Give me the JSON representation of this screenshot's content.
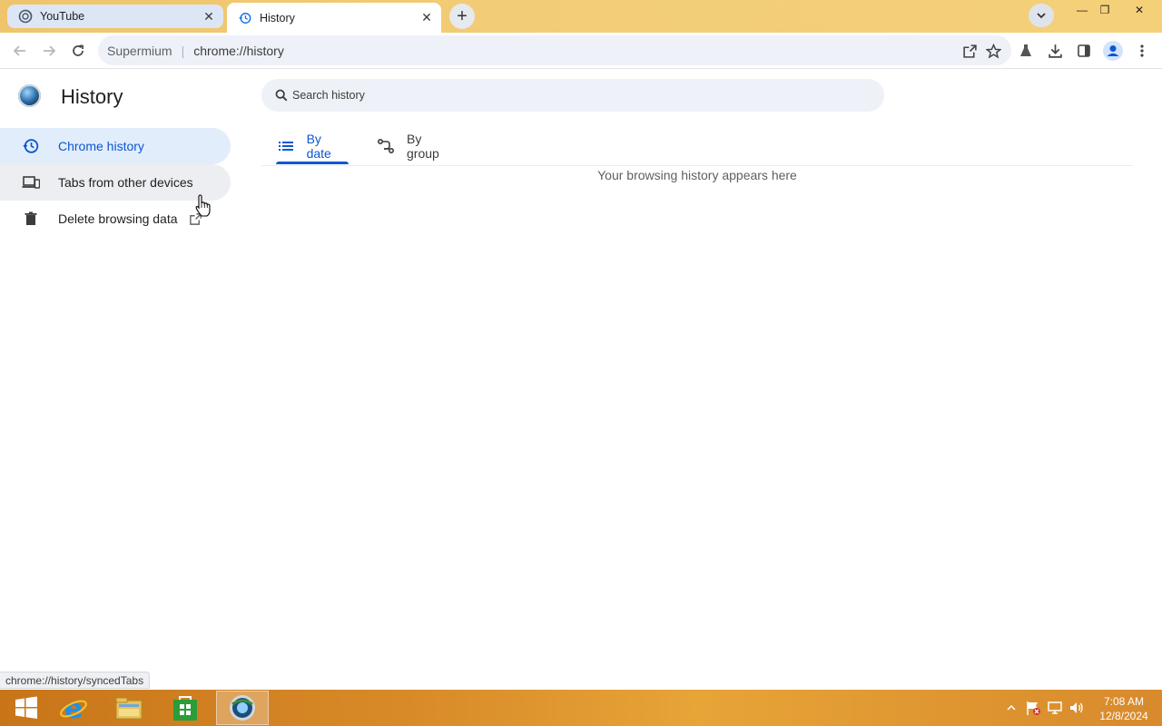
{
  "browser": {
    "tabs": [
      {
        "title": "YouTube",
        "icon": "supermium-favicon",
        "active": false
      },
      {
        "title": "History",
        "icon": "history-favicon",
        "active": true
      }
    ],
    "new_tab_symbol": "+",
    "close_symbol": "✕",
    "window_controls": {
      "minimize": "—",
      "restore": "❐",
      "close": "✕"
    }
  },
  "toolbar": {
    "origin_label": "Supermium",
    "separator": "|",
    "url": "chrome://history"
  },
  "page": {
    "title": "History",
    "search_placeholder": "Search history",
    "sidebar": [
      {
        "label": "Chrome history",
        "icon": "history-clock-icon",
        "state": "selected"
      },
      {
        "label": "Tabs from other devices",
        "icon": "devices-icon",
        "state": "hover"
      },
      {
        "label": "Delete browsing data",
        "icon": "trash-icon",
        "state": "normal",
        "external_icon": "open-in-new-icon"
      }
    ],
    "tabs": [
      {
        "label": "By date",
        "icon": "list-icon",
        "selected": true
      },
      {
        "label": "By group",
        "icon": "group-icon",
        "selected": false
      }
    ],
    "empty_message": "Your browsing history appears here"
  },
  "status_bar": {
    "url": "chrome://history/syncedTabs"
  },
  "taskbar": {
    "apps": [
      "start-button",
      "internet-explorer",
      "file-explorer",
      "windows-store",
      "supermium-browser"
    ],
    "clock": {
      "time": "7:08 AM",
      "date": "12/8/2024"
    }
  },
  "colors": {
    "accent": "#0b57d0",
    "tabstrip": "#f3cd78",
    "selected_nav_bg": "#e2edfb",
    "taskbar": "#d88a28"
  }
}
